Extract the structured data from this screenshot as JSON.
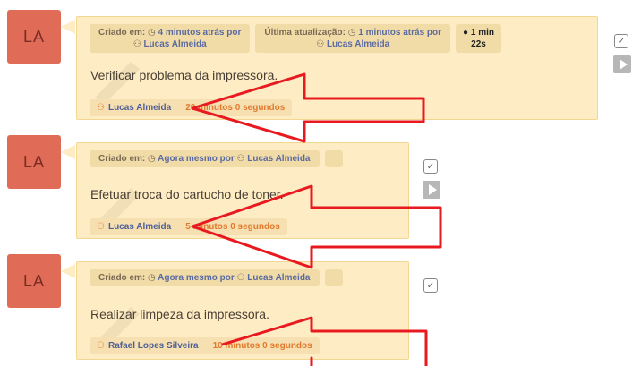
{
  "tasks": [
    {
      "avatar": "LA",
      "created_label": "Criado em:",
      "created_value": "4 minutos atrás por",
      "created_user": "Lucas Almeida",
      "updated_label": "Última atualização:",
      "updated_value": "1 minutos atrás por",
      "updated_user": "Lucas Almeida",
      "timer_line1": "1 min",
      "timer_line2": "22s",
      "title": "Verificar problema da impressora.",
      "assignee": "Lucas Almeida",
      "duration": "20 minutos 0 segundos"
    },
    {
      "avatar": "LA",
      "created_label": "Criado em:",
      "created_value": "Agora mesmo por",
      "created_user": "Lucas Almeida",
      "title": "Efetuar troca do cartucho de toner.",
      "assignee": "Lucas Almeida",
      "duration": "5 minutos 0 segundos"
    },
    {
      "avatar": "LA",
      "created_label": "Criado em:",
      "created_value": "Agora mesmo por",
      "created_user": "Lucas Almeida",
      "title": "Realizar limpeza da impressora.",
      "assignee": "Rafael Lopes Silveira",
      "duration": "10 minutos 0 segundos"
    }
  ],
  "colors": {
    "avatar": "#e06c58",
    "card": "#feedc4",
    "annotation_arrow": "#e8191f"
  }
}
